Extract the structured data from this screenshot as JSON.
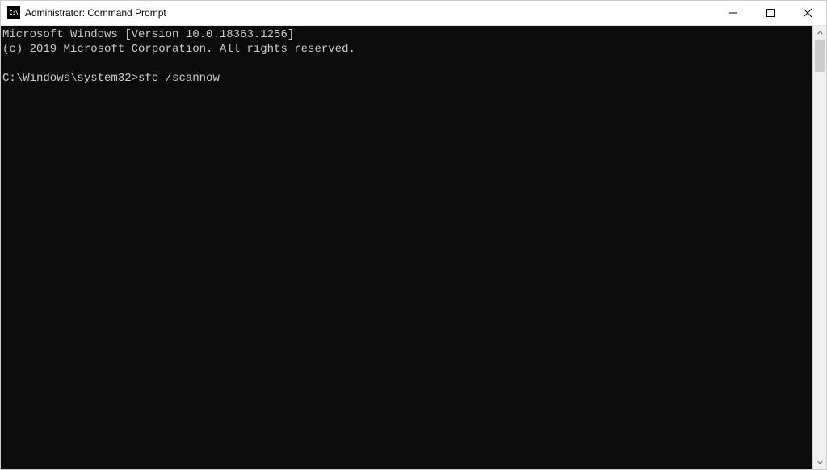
{
  "window": {
    "title": "Administrator: Command Prompt",
    "icon_label": "C:\\"
  },
  "terminal": {
    "header_line1": "Microsoft Windows [Version 10.0.18363.1256]",
    "header_line2": "(c) 2019 Microsoft Corporation. All rights reserved.",
    "prompt": "C:\\Windows\\system32>",
    "command": "sfc /scannow"
  }
}
